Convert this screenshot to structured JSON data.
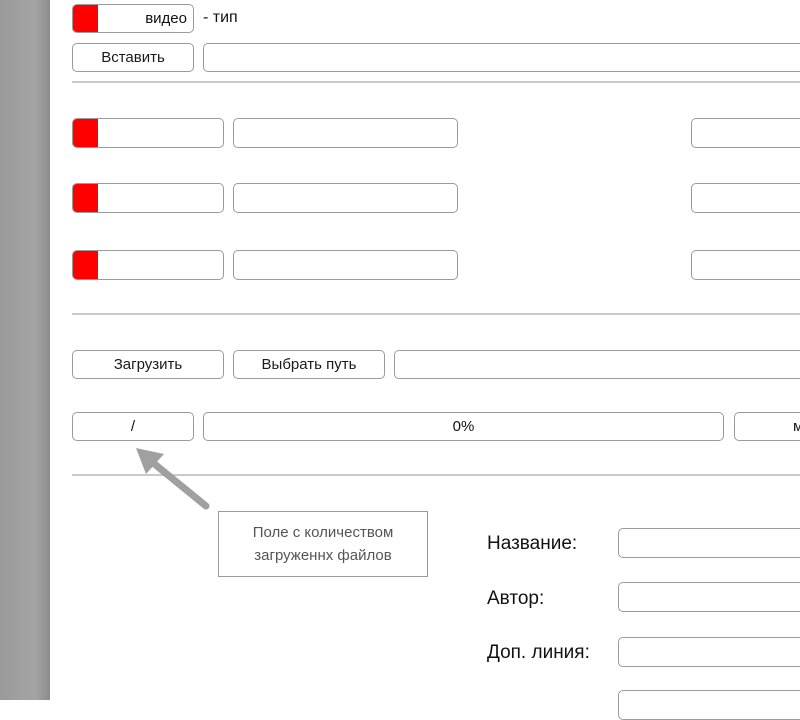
{
  "header": {
    "type_toggle_label": "видео",
    "type_suffix": "- тип",
    "insert_button": "Вставить",
    "insert_value": ""
  },
  "rows": [
    {
      "toggle_label": "",
      "field1": "",
      "field2": ""
    },
    {
      "toggle_label": "",
      "field1": "",
      "field2": ""
    },
    {
      "toggle_label": "",
      "field1": "",
      "field2": ""
    }
  ],
  "upload": {
    "upload_button": "Загрузить",
    "choose_path_button": "Выбрать путь",
    "path_value": "",
    "file_counter": "/",
    "progress_text": "0%",
    "progress": 0,
    "right_button_fragment": "м"
  },
  "annotation": {
    "line1": "Поле с количеством",
    "line2": "загруженнх файлов"
  },
  "form": {
    "title_label": "Название:",
    "author_label": "Автор:",
    "extra_line_label": "Доп. линия:",
    "title_value": "",
    "author_value": "",
    "extra_line_value": ""
  },
  "colors": {
    "toggle_on": "#ff0000",
    "border": "#9b9b9b",
    "divider": "#c9c9c9",
    "arrow": "#a0a0a0"
  }
}
